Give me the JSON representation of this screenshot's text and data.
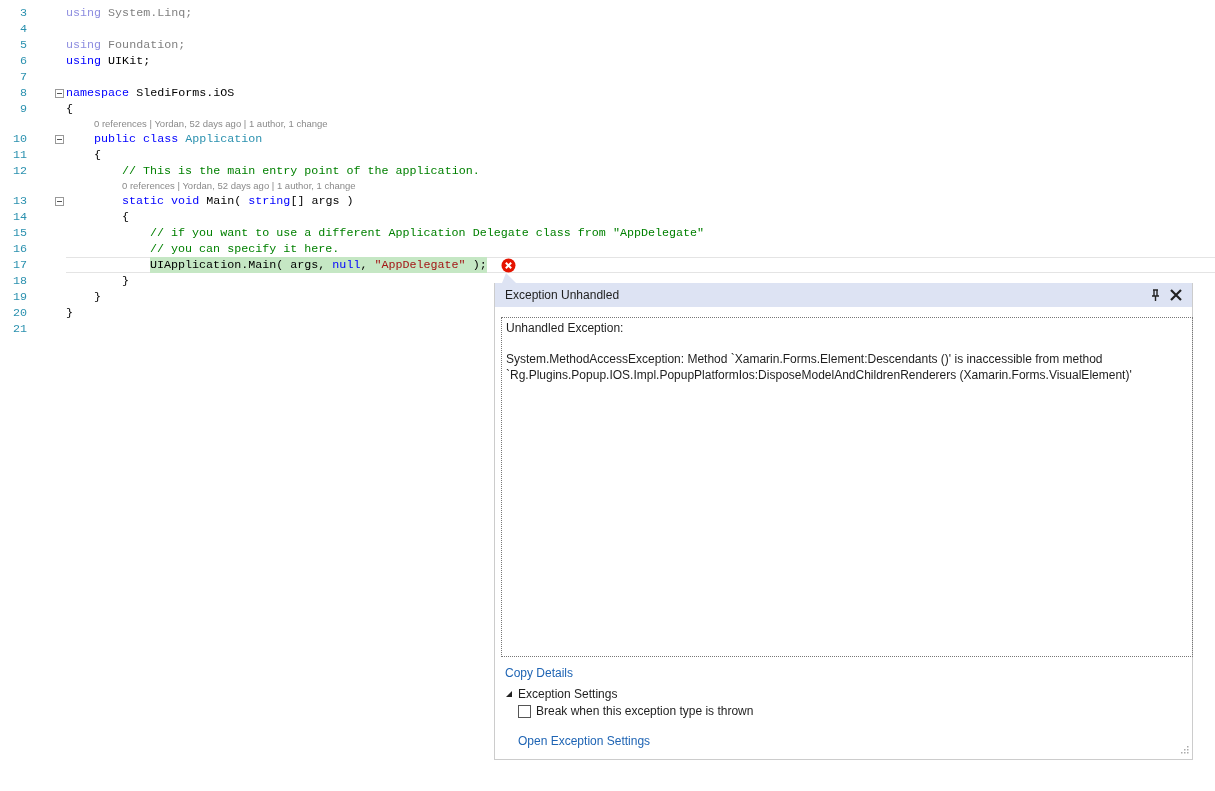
{
  "editor": {
    "rows": [
      {
        "kind": "code",
        "number": "3",
        "tokens": [
          {
            "text": "using",
            "kind": "keyword-dim"
          },
          {
            "text": " System.Linq;",
            "kind": "plain-dim"
          }
        ]
      },
      {
        "kind": "code",
        "number": "4",
        "tokens": []
      },
      {
        "kind": "code",
        "number": "5",
        "tokens": [
          {
            "text": "using",
            "kind": "keyword-dim"
          },
          {
            "text": " Foundation;",
            "kind": "plain-dim"
          }
        ]
      },
      {
        "kind": "code",
        "number": "6",
        "tokens": [
          {
            "text": "using",
            "kind": "keyword"
          },
          {
            "text": " UIKit;",
            "kind": "plain"
          }
        ]
      },
      {
        "kind": "code",
        "number": "7",
        "tokens": []
      },
      {
        "kind": "code",
        "number": "8",
        "expanded": true,
        "tokens": [
          {
            "text": "namespace",
            "kind": "keyword"
          },
          {
            "text": " SlediForms.iOS",
            "kind": "plain"
          }
        ]
      },
      {
        "kind": "code",
        "number": "9",
        "tokens": [
          {
            "text": "{",
            "kind": "plain"
          }
        ],
        "children": [
          {
            "kind": "lens",
            "text": "0 references | Yordan, 52 days ago | 1 author, 1 change"
          },
          {
            "kind": "code",
            "number": "10",
            "expanded": true,
            "tokens": [
              {
                "text": "public",
                "kind": "keyword"
              },
              {
                "text": " class ",
                "kind": "keyword"
              },
              {
                "text": "Application",
                "kind": "type"
              }
            ]
          },
          {
            "kind": "code",
            "number": "11",
            "tokens": [
              {
                "text": "{",
                "kind": "plain"
              }
            ],
            "children": [
              {
                "kind": "code",
                "number": "12",
                "tokens": [
                  {
                    "text": "// This is the main entry point of the application.",
                    "kind": "comment"
                  }
                ]
              },
              {
                "kind": "lens",
                "text": "0 references | Yordan, 52 days ago | 1 author, 1 change"
              },
              {
                "kind": "code",
                "number": "13",
                "expanded": true,
                "tokens": [
                  {
                    "text": "static",
                    "kind": "keyword"
                  },
                  {
                    "text": " void",
                    "kind": "keyword"
                  },
                  {
                    "text": " Main( ",
                    "kind": "plain"
                  },
                  {
                    "text": "string",
                    "kind": "keyword"
                  },
                  {
                    "text": "[] args )",
                    "kind": "plain"
                  }
                ]
              },
              {
                "kind": "code",
                "number": "14",
                "tokens": [
                  {
                    "text": "{",
                    "kind": "plain"
                  }
                ],
                "children": [
                  {
                    "kind": "code",
                    "number": "15",
                    "tokens": [
                      {
                        "text": "// if you want to use a different Application Delegate class from \"AppDelegate\"",
                        "kind": "comment"
                      }
                    ]
                  },
                  {
                    "kind": "code",
                    "number": "16",
                    "tokens": [
                      {
                        "text": "// you can specify it here.",
                        "kind": "comment"
                      }
                    ]
                  },
                  {
                    "kind": "code",
                    "number": "17",
                    "highlight": true,
                    "error": true,
                    "tokens": [
                      {
                        "text": "UIApplication.Main( args, ",
                        "kind": "plain"
                      },
                      {
                        "text": "null",
                        "kind": "keyword"
                      },
                      {
                        "text": ", ",
                        "kind": "plain"
                      },
                      {
                        "text": "\"AppDelegate\"",
                        "kind": "string"
                      },
                      {
                        "text": " );",
                        "kind": "plain"
                      }
                    ]
                  }
                ]
              },
              {
                "kind": "code",
                "number": "18",
                "tokens": [
                  {
                    "text": "}",
                    "kind": "plain"
                  }
                ]
              }
            ]
          },
          {
            "kind": "code",
            "number": "19",
            "tokens": [
              {
                "text": "}",
                "kind": "plain"
              }
            ]
          }
        ]
      },
      {
        "kind": "code",
        "number": "20",
        "tokens": [
          {
            "text": "}",
            "kind": "plain"
          }
        ]
      },
      {
        "kind": "code",
        "number": "21",
        "tokens": []
      }
    ]
  },
  "exception_popup": {
    "title": "Exception Unhandled",
    "heading": "Unhandled Exception:",
    "message_lines": [
      "System.MethodAccessException: Method `Xamarin.Forms.Element:Descendants ()' is inaccessible from method",
      "`Rg.Plugins.Popup.IOS.Impl.PopupPlatformIos:DisposeModelAndChildrenRenderers (Xamarin.Forms.VisualElement)'"
    ],
    "copy_details": "Copy Details",
    "settings": {
      "label": "Exception Settings",
      "expanded": true,
      "break_option": {
        "label": "Break when this exception type is thrown",
        "checked": false
      },
      "open_link": "Open Exception Settings"
    }
  }
}
